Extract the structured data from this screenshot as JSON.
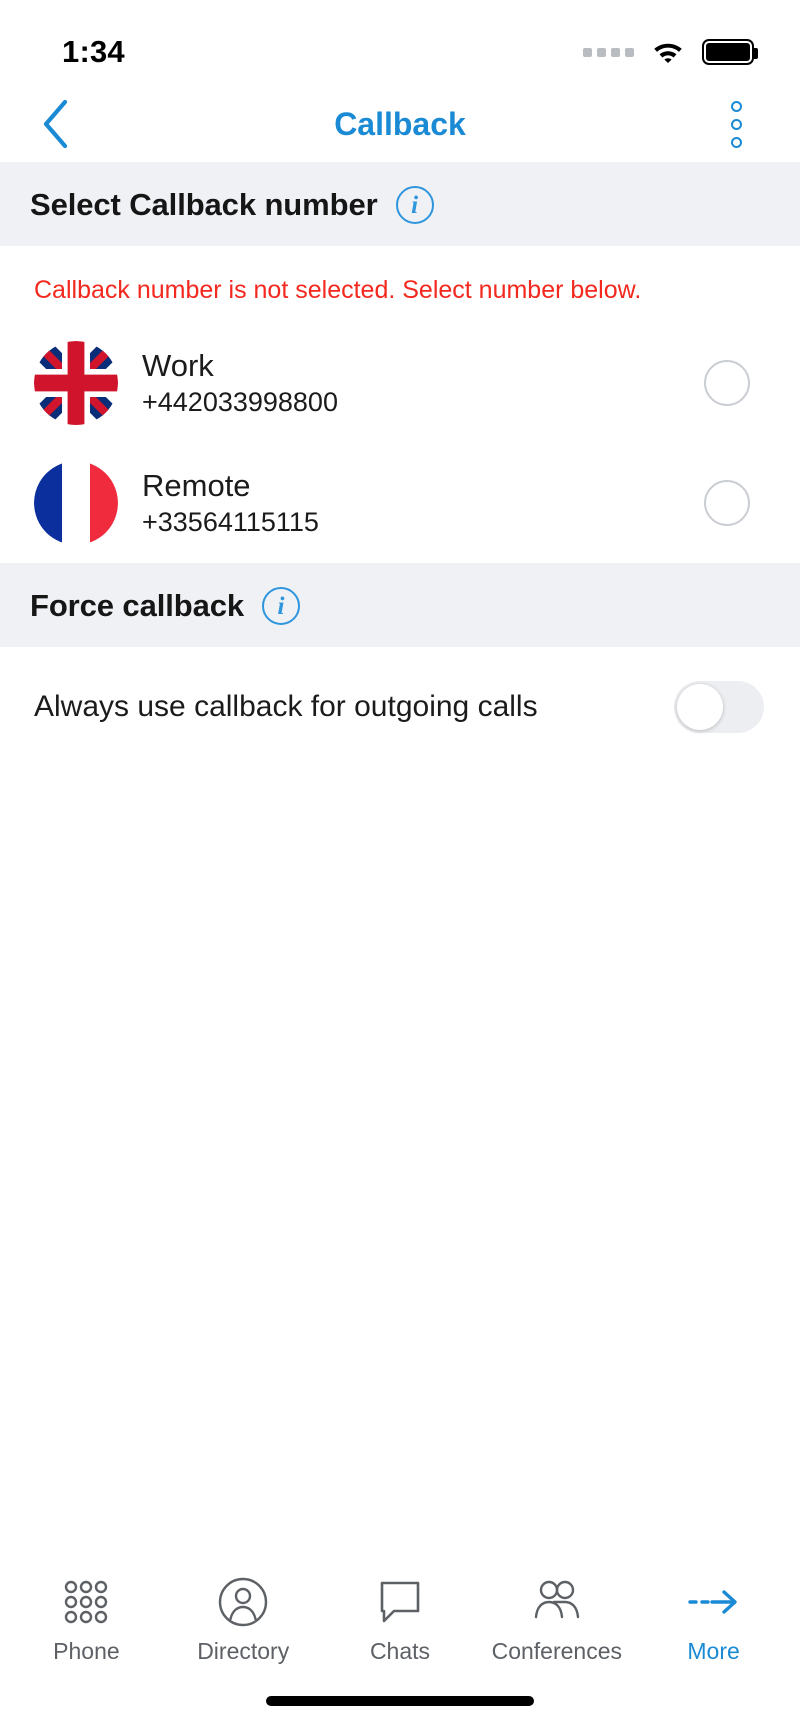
{
  "status_bar": {
    "time": "1:34",
    "signal_icon": "signal-dots-icon",
    "wifi_icon": "wifi-icon",
    "battery_icon": "battery-full-icon"
  },
  "nav": {
    "back_icon": "chevron-left-icon",
    "title": "Callback",
    "more_icon": "overflow-menu-icon"
  },
  "sections": {
    "select_number": {
      "title": "Select Callback number",
      "info_icon": "info-icon",
      "info_glyph": "i",
      "warning": "Callback number is not selected. Select number below."
    },
    "force_callback": {
      "title": "Force callback",
      "info_icon": "info-icon",
      "info_glyph": "i",
      "toggle_label": "Always use callback for outgoing calls",
      "toggle_state": "off"
    }
  },
  "numbers": [
    {
      "label": "Work",
      "value": "+442033998800",
      "flag": "united-kingdom-flag-icon",
      "selected": false
    },
    {
      "label": "Remote",
      "value": "+33564115115",
      "flag": "france-flag-icon",
      "selected": false
    }
  ],
  "tabs": [
    {
      "label": "Phone",
      "icon": "keypad-icon",
      "active": false
    },
    {
      "label": "Directory",
      "icon": "contact-icon",
      "active": false
    },
    {
      "label": "Chats",
      "icon": "chat-bubble-icon",
      "active": false
    },
    {
      "label": "Conferences",
      "icon": "group-icon",
      "active": false
    },
    {
      "label": "More",
      "icon": "arrow-right-icon",
      "active": true
    }
  ],
  "colors": {
    "accent": "#1a8ad5",
    "error": "#f3281e",
    "section_bg": "#eff1f5",
    "text": "#1b1b1b",
    "muted": "#5d6166"
  }
}
